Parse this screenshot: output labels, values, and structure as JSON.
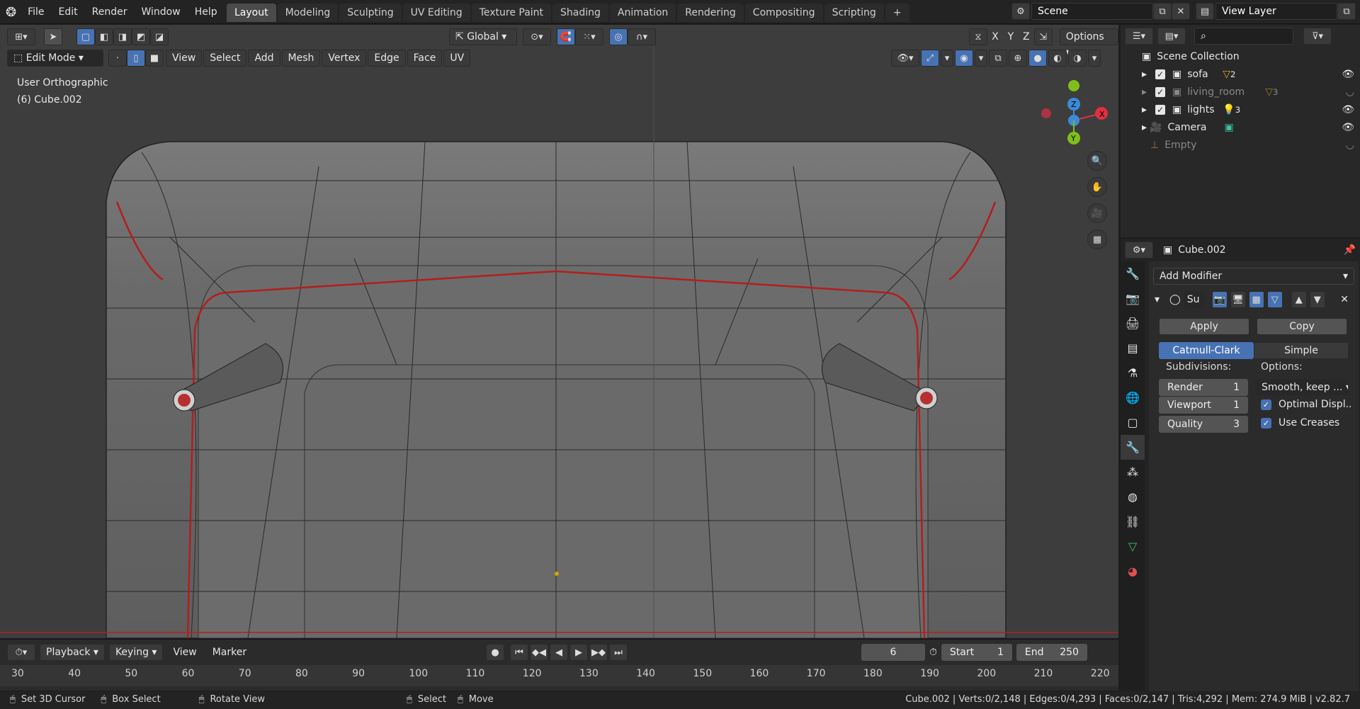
{
  "topbar": {
    "menus": [
      "File",
      "Edit",
      "Render",
      "Window",
      "Help"
    ],
    "tabs": [
      "Layout",
      "Modeling",
      "Sculpting",
      "UV Editing",
      "Texture Paint",
      "Shading",
      "Animation",
      "Rendering",
      "Compositing",
      "Scripting",
      "+"
    ],
    "scene": "Scene",
    "view_layer": "View Layer"
  },
  "viewport": {
    "orientation": "Global",
    "options": "Options",
    "axes": [
      "X",
      "Y",
      "Z"
    ],
    "mode": "Edit Mode",
    "menus": [
      "View",
      "Select",
      "Add",
      "Mesh",
      "Vertex",
      "Edge",
      "Face",
      "UV"
    ],
    "overlay_view": "User Orthographic",
    "overlay_object": "(6) Cube.002",
    "gizmo": {
      "x": "X",
      "y": "Y",
      "z": "Z"
    }
  },
  "timeline": {
    "menus": [
      "Playback",
      "Keying",
      "View",
      "Marker"
    ],
    "current_frame": "6",
    "start_label": "Start",
    "start": "1",
    "end_label": "End",
    "end": "250",
    "ticks": [
      "30",
      "40",
      "50",
      "60",
      "70",
      "80",
      "90",
      "100",
      "110",
      "120",
      "130",
      "140",
      "150",
      "160",
      "170",
      "180",
      "190",
      "200",
      "210",
      "220"
    ]
  },
  "status": {
    "hints": [
      "Set 3D Cursor",
      "Box Select",
      "Rotate View",
      "Select",
      "Move"
    ],
    "stats": "Cube.002 | Verts:0/2,148 | Edges:0/4,293 | Faces:0/2,147 | Tris:4,292 | Mem: 274.9 MiB | v2.82.7"
  },
  "outliner": {
    "root": "Scene Collection",
    "items": [
      {
        "name": "sofa",
        "badge": "2"
      },
      {
        "name": "living_room",
        "badge": "3"
      },
      {
        "name": "lights",
        "badge": "3"
      },
      {
        "name": "Camera"
      },
      {
        "name": "Empty"
      }
    ]
  },
  "properties": {
    "object": "Cube.002",
    "add_modifier": "Add Modifier",
    "modifier_short": "Su",
    "apply": "Apply",
    "copy": "Copy",
    "catmull": "Catmull-Clark",
    "simple": "Simple",
    "subdiv_label": "Subdivisions:",
    "options_label": "Options:",
    "render_label": "Render",
    "render": "1",
    "viewport_label": "Viewport",
    "viewport": "1",
    "quality_label": "Quality",
    "quality": "3",
    "uv_smooth": "Smooth, keep ...",
    "optimal": "Optimal Displ..",
    "creases": "Use Creases"
  }
}
